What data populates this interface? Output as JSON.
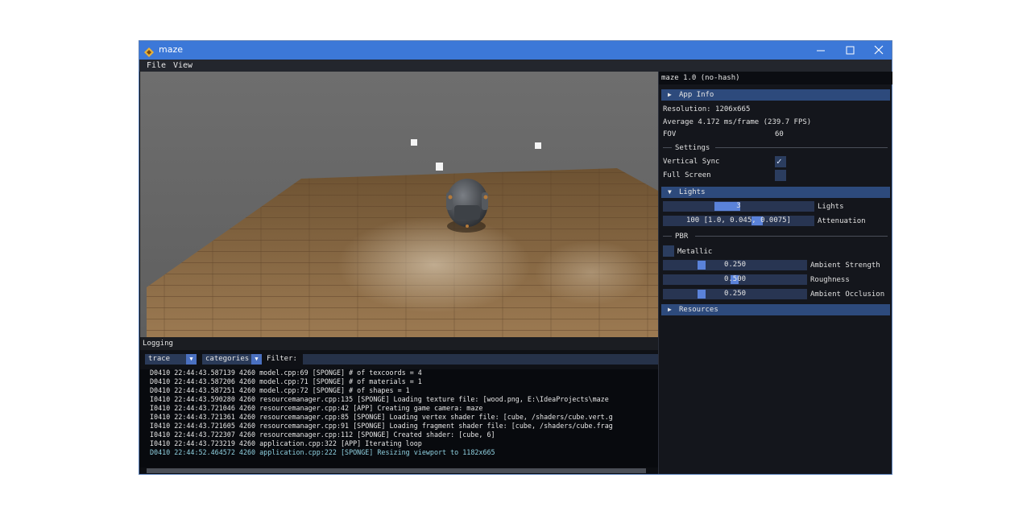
{
  "window": {
    "title": "maze",
    "minimize_icon": "minimize-icon",
    "maximize_icon": "maximize-icon",
    "close_icon": "close-icon",
    "accent": "#3c78d8"
  },
  "menubar": {
    "items": [
      "File",
      "View"
    ]
  },
  "panel": {
    "title": "maze 1.0 (no-hash)",
    "app_info": {
      "header": "App Info",
      "resolution": "Resolution: 1206x665",
      "average": "Average 4.172 ms/frame (239.7 FPS)",
      "fov_label": "FOV",
      "fov_value": "60"
    },
    "settings": {
      "header": "Settings",
      "vsync_label": "Vertical Sync",
      "vsync_checked": true,
      "fullscreen_label": "Full Screen",
      "fullscreen_checked": false
    },
    "lights": {
      "header": "Lights",
      "count_value": "3",
      "count_label": "Lights",
      "attenuation_value": "100 [1.0, 0.045, 0.0075]",
      "attenuation_label": "Attenuation"
    },
    "pbr": {
      "header": "PBR",
      "metallic_label": "Metallic",
      "metallic_checked": false,
      "ambient_strength_value": "0.250",
      "ambient_strength_label": "Ambient Strength",
      "roughness_value": "0.500",
      "roughness_label": "Roughness",
      "ambient_occlusion_value": "0.250",
      "ambient_occlusion_label": "Ambient Occlusion"
    },
    "resources": {
      "header": "Resources"
    }
  },
  "logging": {
    "title": "Logging",
    "level": "trace",
    "categories": "categories",
    "filter_label": "Filter:",
    "filter_value": "",
    "lines": [
      {
        "text": "D0410 22:44:43.587139    4260 model.cpp:69 [SPONGE] # of texcoords = 4",
        "color": "#e6e6e6"
      },
      {
        "text": "D0410 22:44:43.587206    4260 model.cpp:71 [SPONGE] # of materials = 1",
        "color": "#e6e6e6"
      },
      {
        "text": "D0410 22:44:43.587251    4260 model.cpp:72 [SPONGE] # of shapes    = 1",
        "color": "#e6e6e6"
      },
      {
        "text": "I0410 22:44:43.590280    4260 resourcemanager.cpp:135 [SPONGE] Loading texture file: [wood.png, E:\\IdeaProjects\\maze",
        "color": "#e6e6e6"
      },
      {
        "text": "I0410 22:44:43.721046    4260 resourcemanager.cpp:42 [APP] Creating game camera: maze",
        "color": "#e6e6e6"
      },
      {
        "text": "I0410 22:44:43.721361    4260 resourcemanager.cpp:85 [SPONGE] Loading vertex shader file: [cube, /shaders/cube.vert.g",
        "color": "#e6e6e6"
      },
      {
        "text": "I0410 22:44:43.721605    4260 resourcemanager.cpp:91 [SPONGE] Loading fragment shader file: [cube, /shaders/cube.frag",
        "color": "#e6e6e6"
      },
      {
        "text": "I0410 22:44:43.722307    4260 resourcemanager.cpp:112 [SPONGE] Created shader: [cube, 6]",
        "color": "#e6e6e6"
      },
      {
        "text": "I0410 22:44:43.723219    4260 application.cpp:322 [APP] Iterating loop",
        "color": "#e6e6e6"
      },
      {
        "text": "D0410 22:44:52.464572    4260 application.cpp:222 [SPONGE] Resizing viewport to 1182x665",
        "color": "#8fd0e0"
      }
    ]
  },
  "colors": {
    "wall": "#6b6b6b",
    "floor": "#8a6a45",
    "panel_bg": "#14161c",
    "section_header": "#2d4a7c",
    "slider_grab": "#5a82d9"
  }
}
